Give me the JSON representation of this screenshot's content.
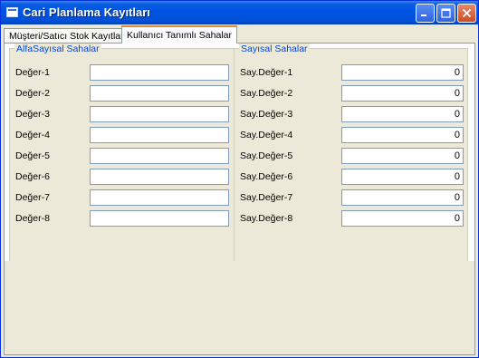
{
  "window": {
    "title": "Cari Planlama Kayıtları"
  },
  "tabs": [
    {
      "label": "Müşteri/Satıcı Stok Kayıtları"
    },
    {
      "label": "Kullanıcı Tanımlı Sahalar"
    }
  ],
  "alpha_group": {
    "title": "AlfaSayısal Sahalar",
    "rows": [
      {
        "label": "Değer-1",
        "value": ""
      },
      {
        "label": "Değer-2",
        "value": ""
      },
      {
        "label": "Değer-3",
        "value": ""
      },
      {
        "label": "Değer-4",
        "value": ""
      },
      {
        "label": "Değer-5",
        "value": ""
      },
      {
        "label": "Değer-6",
        "value": ""
      },
      {
        "label": "Değer-7",
        "value": ""
      },
      {
        "label": "Değer-8",
        "value": ""
      }
    ]
  },
  "numeric_group": {
    "title": "Sayısal Sahalar",
    "rows": [
      {
        "label": "Say.Değer-1",
        "value": "0"
      },
      {
        "label": "Say.Değer-2",
        "value": "0"
      },
      {
        "label": "Say.Değer-3",
        "value": "0"
      },
      {
        "label": "Say.Değer-4",
        "value": "0"
      },
      {
        "label": "Say.Değer-5",
        "value": "0"
      },
      {
        "label": "Say.Değer-6",
        "value": "0"
      },
      {
        "label": "Say.Değer-7",
        "value": "0"
      },
      {
        "label": "Say.Değer-8",
        "value": "0"
      }
    ]
  }
}
